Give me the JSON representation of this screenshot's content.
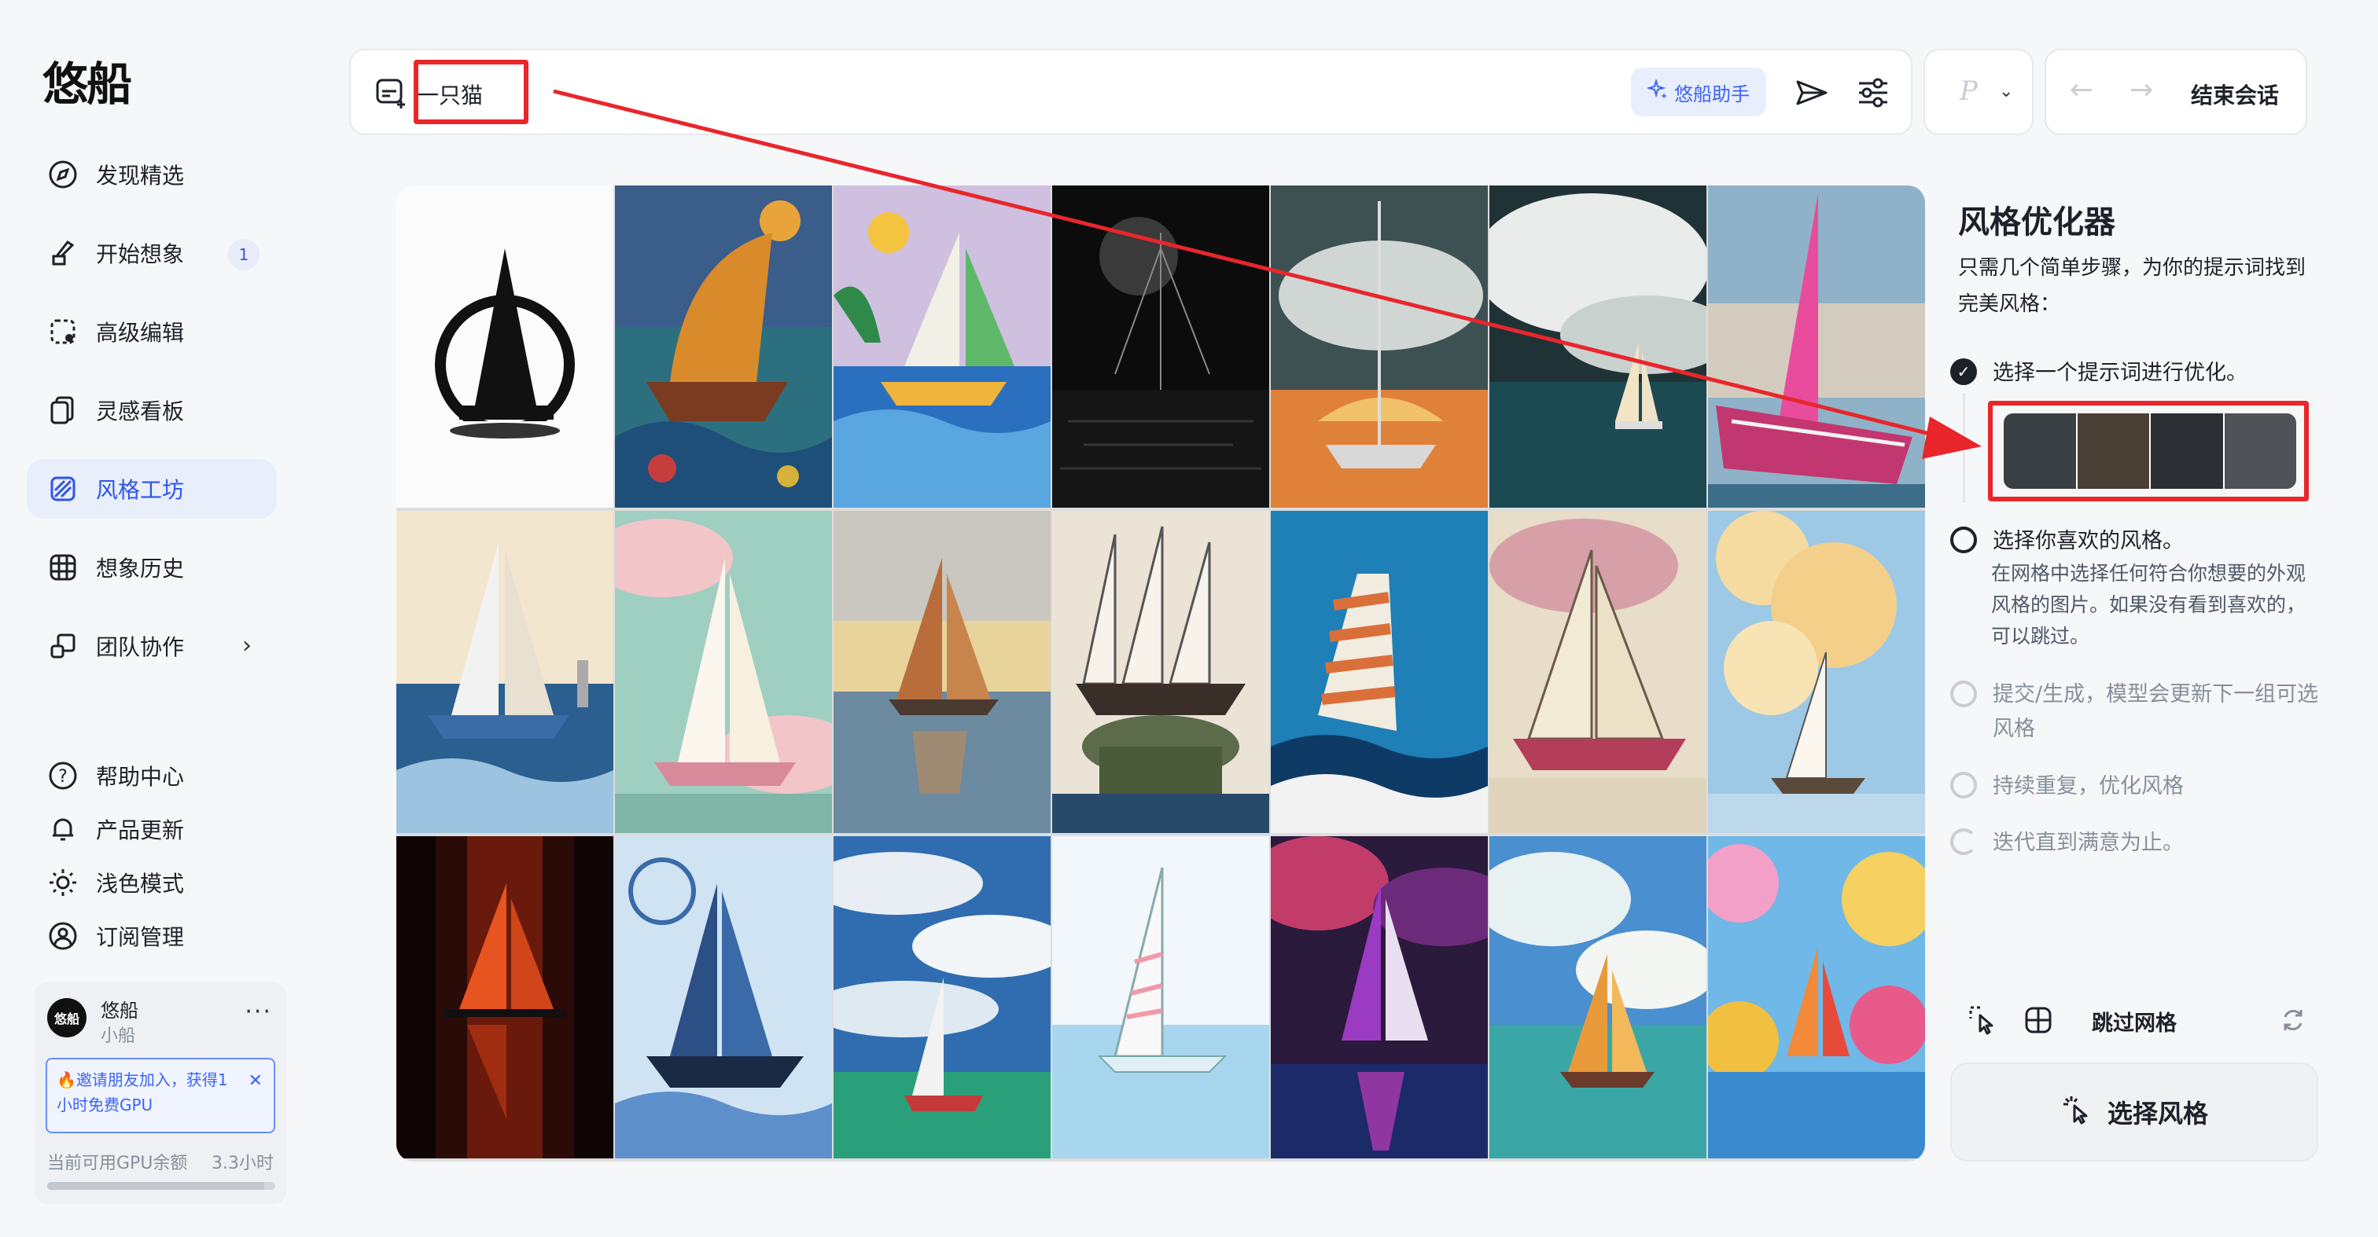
{
  "app": {
    "logo": "悠船"
  },
  "nav": [
    {
      "id": "discover",
      "label": "发现精选",
      "icon": "compass-icon"
    },
    {
      "id": "imagine",
      "label": "开始想象",
      "icon": "brush-icon",
      "badge": "1"
    },
    {
      "id": "edit",
      "label": "高级编辑",
      "icon": "edit-frame-icon"
    },
    {
      "id": "board",
      "label": "灵感看板",
      "icon": "cards-icon"
    },
    {
      "id": "style",
      "label": "风格工坊",
      "icon": "palette-icon",
      "active": true
    },
    {
      "id": "history",
      "label": "想象历史",
      "icon": "grid-icon"
    },
    {
      "id": "team",
      "label": "团队协作",
      "icon": "team-icon",
      "has_submenu": true
    }
  ],
  "utility": [
    {
      "id": "help",
      "label": "帮助中心",
      "icon": "help-circle-icon"
    },
    {
      "id": "updates",
      "label": "产品更新",
      "icon": "bell-icon"
    },
    {
      "id": "theme",
      "label": "浅色模式",
      "icon": "sun-icon"
    },
    {
      "id": "subscription",
      "label": "订阅管理",
      "icon": "user-circle-icon"
    }
  ],
  "user": {
    "avatar_text": "悠船",
    "name": "悠船",
    "plan": "小船",
    "invite_text": "🔥邀请朋友加入，获得1小时免费GPU",
    "gpu_label": "当前可用GPU余额",
    "gpu_value": "3.3小时",
    "gpu_fraction": 0.95
  },
  "prompt": {
    "text": "一只猫",
    "assistant_label": "悠船助手"
  },
  "model": {
    "label": "P"
  },
  "session": {
    "end_label": "结束会话"
  },
  "panel": {
    "title": "风格优化器",
    "description": "只需几个简单步骤，为你的提示词找到完美风格：",
    "steps": [
      {
        "label": "选择一个提示词进行优化。",
        "state": "done"
      },
      {
        "label": "选择你喜欢的风格。",
        "state": "current",
        "detail": "在网格中选择任何符合你想要的外观风格的图片。如果没有看到喜欢的，可以跳过。"
      },
      {
        "label": "提交/生成，模型会更新下一组可选风格",
        "state": "pending"
      },
      {
        "label": "持续重复，优化风格",
        "state": "pending"
      },
      {
        "label": "迭代直到满意为止。",
        "state": "pending"
      }
    ],
    "skip_label": "跳过网格",
    "choose_label": "选择风格"
  },
  "grid_tiles": [
    "tile-1",
    "tile-2",
    "tile-3",
    "tile-4",
    "tile-5",
    "tile-6",
    "tile-7",
    "tile-8",
    "tile-9",
    "tile-10",
    "tile-11",
    "tile-12",
    "tile-13",
    "tile-14",
    "tile-15",
    "tile-16",
    "tile-17",
    "tile-18",
    "tile-19",
    "tile-20",
    "tile-21"
  ],
  "colors": {
    "accent": "#2f54eb",
    "annotation": "#e8262b"
  }
}
